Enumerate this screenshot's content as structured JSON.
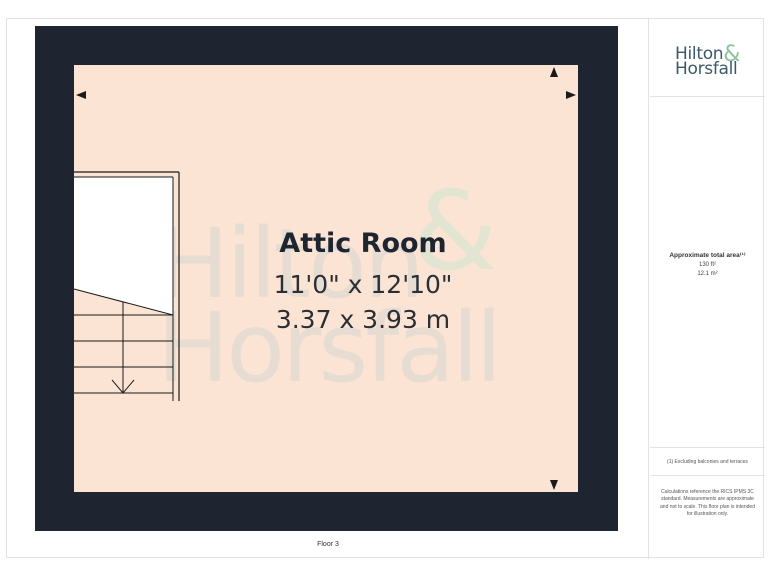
{
  "brand": {
    "line1": "Hilton",
    "amp": "&",
    "line2": "Horsfall"
  },
  "room": {
    "name": "Attic Room",
    "imperial": "11'0\" x 12'10\"",
    "metric": "3.37 x 3.93 m"
  },
  "floor_label": "Floor 3",
  "area": {
    "title": "Approximate total area⁽¹⁾",
    "imperial": "130 ft²",
    "metric": "12.1 m²"
  },
  "footnote": "(1) Excluding balconies and terraces",
  "disclaimer": "Calculations reference the RICS IPMS 3C standard. Measurements are approximate and not to scale. This floor plan is intended for illustration only.",
  "colors": {
    "wall": "#1e2530",
    "floor": "#fbe4d4",
    "stair_fill": "#ffffff",
    "line": "#1a1a1a",
    "brand_text": "#3a5a6a",
    "brand_amp": "#8ec39a"
  }
}
